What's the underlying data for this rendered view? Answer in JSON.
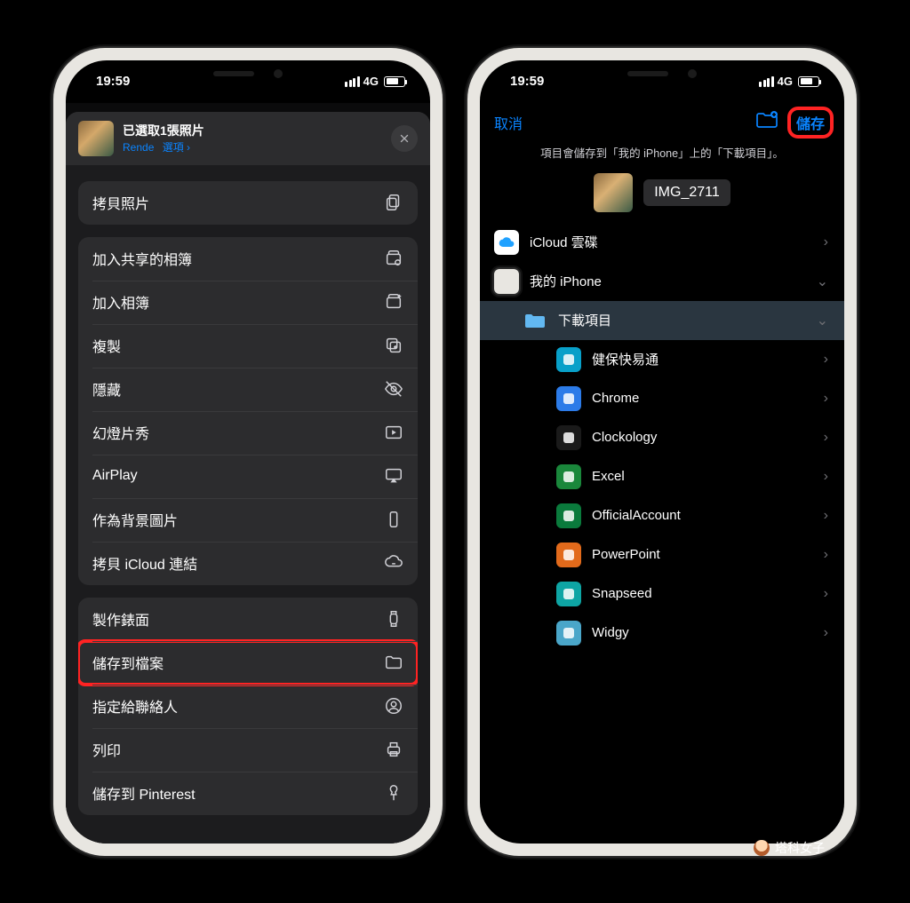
{
  "status": {
    "time": "19:59",
    "network_label": "4G"
  },
  "share_sheet": {
    "header_title": "已選取1張照片",
    "header_sub_location": "Rende",
    "header_options_link": "選項 ›",
    "actions_block1": [
      {
        "label": "拷貝照片",
        "icon": "copy-doc-icon"
      }
    ],
    "actions_block2": [
      {
        "label": "加入共享的相簿",
        "icon": "shared-album-icon"
      },
      {
        "label": "加入相簿",
        "icon": "add-album-icon"
      },
      {
        "label": "複製",
        "icon": "duplicate-icon"
      },
      {
        "label": "隱藏",
        "icon": "eye-slash-icon"
      },
      {
        "label": "幻燈片秀",
        "icon": "slideshow-icon"
      },
      {
        "label": "AirPlay",
        "icon": "airplay-icon"
      },
      {
        "label": "作為背景圖片",
        "icon": "wallpaper-icon"
      },
      {
        "label": "拷貝 iCloud 連結",
        "icon": "cloud-link-icon"
      }
    ],
    "actions_block3": [
      {
        "label": "製作錶面",
        "icon": "watch-icon"
      },
      {
        "label": "儲存到檔案",
        "icon": "folder-icon",
        "highlight": true
      },
      {
        "label": "指定給聯絡人",
        "icon": "contact-icon"
      },
      {
        "label": "列印",
        "icon": "print-icon"
      },
      {
        "label": "儲存到 Pinterest",
        "icon": "pin-icon"
      }
    ]
  },
  "files_picker": {
    "cancel": "取消",
    "save": "儲存",
    "hint": "項目會儲存到「我的 iPhone」上的「下載項目」。",
    "filename": "IMG_2711",
    "locations": {
      "icloud": {
        "label": "iCloud 雲碟"
      },
      "device": {
        "label": "我的 iPhone"
      }
    },
    "device_children": [
      {
        "label": "下載項目",
        "icon": "folder",
        "selected": true,
        "chev": "down"
      },
      {
        "label": "健保快易通",
        "icon": "shield"
      },
      {
        "label": "Chrome",
        "icon": "blue"
      },
      {
        "label": "Clockology",
        "icon": "dark"
      },
      {
        "label": "Excel",
        "icon": "green"
      },
      {
        "label": "OfficialAccount",
        "icon": "dgreen"
      },
      {
        "label": "PowerPoint",
        "icon": "orange"
      },
      {
        "label": "Snapseed",
        "icon": "teal"
      },
      {
        "label": "Widgy",
        "icon": "gray"
      }
    ]
  },
  "watermark": "塔科女子"
}
